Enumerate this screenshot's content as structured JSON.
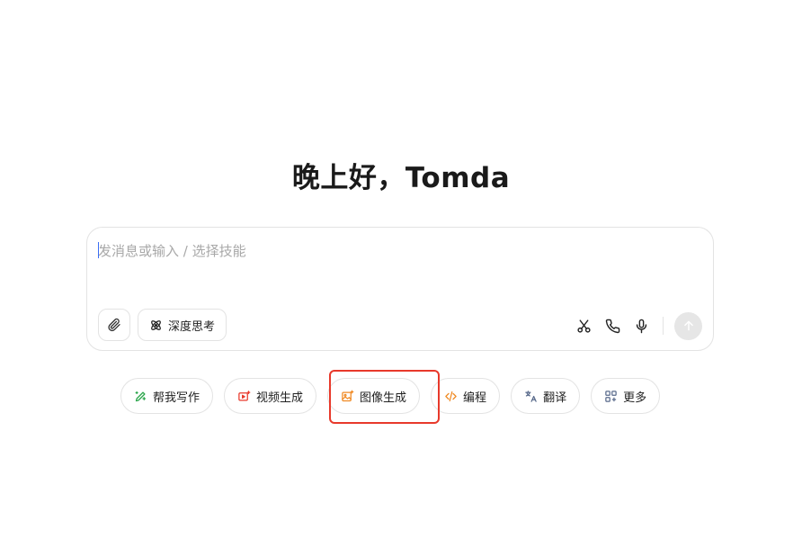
{
  "greeting": "晚上好，Tomda",
  "composer": {
    "placeholder": "发消息或输入 / 选择技能",
    "attach_icon": "paperclip-icon",
    "deep_think_label": "深度思考",
    "deep_think_icon": "atom-icon",
    "tools": [
      "scissors-icon",
      "phone-icon",
      "microphone-icon"
    ],
    "send_icon": "arrow-up-icon"
  },
  "quick_actions": [
    {
      "label": "帮我写作",
      "icon": "pen-sparkle-icon",
      "color": "#2aa54a"
    },
    {
      "label": "视频生成",
      "icon": "video-play-icon",
      "color": "#e8392b"
    },
    {
      "label": "图像生成",
      "icon": "image-sparkle-icon",
      "color": "#f08a24"
    },
    {
      "label": "编程",
      "icon": "code-icon",
      "color": "#f08a24"
    },
    {
      "label": "翻译",
      "icon": "translate-icon",
      "color": "#5a6b8c"
    },
    {
      "label": "更多",
      "icon": "grid-apps-icon",
      "color": "#5a6b8c"
    }
  ],
  "highlight": {
    "target": "图像生成",
    "color": "#e8392b"
  }
}
